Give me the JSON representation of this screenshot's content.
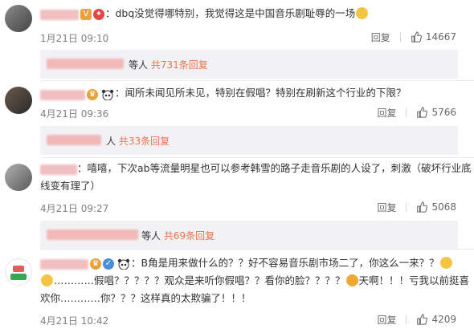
{
  "comments": [
    {
      "text": "：dbq没觉得哪特别，我觉得这是中国音乐剧耻辱的一场",
      "time": "1月21日 09:10",
      "reply_label": "回复",
      "likes": "14667",
      "thread_suffix": "等人",
      "thread_count": "共731条回复"
    },
    {
      "text": "：闻所未闻见所未见，特别在假唱？特别在刷新这个行业的下限？",
      "time": "4月21日 09:36",
      "reply_label": "回复",
      "likes": "5766",
      "thread_suffix": "人",
      "thread_count": "共33条回复"
    },
    {
      "line1": "：嘻嘻，下次ab等流量明星也可以参考韩雪的路子走音乐剧的人设了，刺激（破坏行业底",
      "line2": "线变有理了）",
      "time": "4月21日 09:27",
      "reply_label": "回复",
      "likes": "5068",
      "thread_suffix": "等人",
      "thread_count": "共69条回复"
    },
    {
      "line1": "：B角是用来做什么的？？好不容易音乐剧市场⼆了，你这么一来？？",
      "line2a": "…………假唱？？？？？观众是来听你假唱？？看你的脸？？？？",
      "line2b": "天啊！！！亏我以前挺喜",
      "line3": "欢你…………你？？？这样真的太欺骗了！！！",
      "time": "4月21日 10:42",
      "reply_label": "回复",
      "likes": "4209"
    }
  ],
  "colors": {
    "reply_count": "#eb7350",
    "time": "#808080",
    "reply_bg": "#f2f2f5"
  },
  "icons": [
    "like-icon",
    "panda-icon",
    "emoji-face-icon",
    "badge-icon"
  ]
}
